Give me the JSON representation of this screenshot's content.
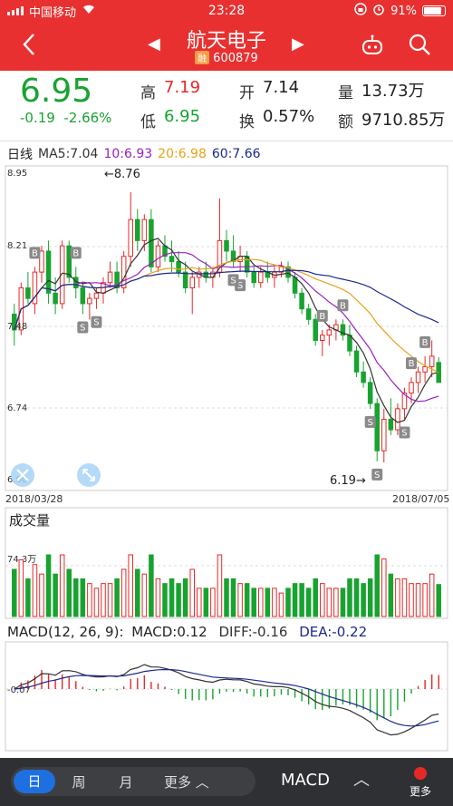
{
  "status": {
    "carrier": "中国移动",
    "time": "23:28",
    "battery": "91%"
  },
  "nav": {
    "stock_name": "航天电子",
    "rong_badge": "融",
    "stock_code": "600879",
    "prev": "◀",
    "next": "▶",
    "back": "〈"
  },
  "quote": {
    "price": "6.95",
    "change": "-0.19",
    "change_pct": "-2.66%",
    "high_label": "高",
    "high": "7.19",
    "low_label": "低",
    "low": "6.95",
    "open_label": "开",
    "open": "7.14",
    "turnover_label": "换",
    "turnover": "0.57%",
    "volume_label": "量",
    "volume": "13.73万",
    "amount_label": "额",
    "amount": "9710.85万"
  },
  "ma_legend": {
    "period": "日线",
    "ma5": "MA5:7.04",
    "ma10": "10:6.93",
    "ma20": "20:6.98",
    "ma60": "60:7.66"
  },
  "colors": {
    "up": "#e62828",
    "down": "#18a330",
    "ma5": "#333333",
    "ma10": "#9b1fc1",
    "ma20": "#e7a21a",
    "ma60": "#1a2a8c",
    "header": "#e93030"
  },
  "price_axis": {
    "p1": "8.95",
    "p2": "8.21",
    "p3": "7.48",
    "p4": "6.74",
    "p5": "6.00",
    "start_date": "2018/03/28",
    "end_date": "2018/07/05",
    "high_mark": "←8.76",
    "low_mark": "6.19→"
  },
  "volume_panel": {
    "title": "成交量",
    "max_label": "74.3万"
  },
  "macd_panel": {
    "legend": "MACD(12, 26, 9):",
    "macd": "MACD:0.12",
    "diff": "DIFF:-0.16",
    "dea": "DEA:-0.22",
    "axis_label": "-0.07"
  },
  "bottom": {
    "day": "日",
    "week": "周",
    "month": "月",
    "more_period": "更多 ︿",
    "indicator": "MACD",
    "caret": "︿",
    "more": "更多"
  },
  "chart_data": {
    "type": "candlestick",
    "x_range": [
      "2018/03/28",
      "2018/07/05"
    ],
    "ylim": [
      6.0,
      8.95
    ],
    "y_ticks": [
      8.95,
      8.21,
      7.48,
      6.74,
      6.0
    ],
    "annotations": [
      {
        "text": "←8.76",
        "value": 8.76
      },
      {
        "text": "6.19→",
        "value": 6.19
      }
    ],
    "markers": [
      "B",
      "S",
      "S",
      "B",
      "S",
      "S",
      "B",
      "B",
      "S",
      "S",
      "S",
      "B",
      "B"
    ],
    "candles_ohlc": [
      [
        7.6,
        7.7,
        7.3,
        7.45
      ],
      [
        7.45,
        7.9,
        7.4,
        7.85
      ],
      [
        7.85,
        8.0,
        7.7,
        7.75
      ],
      [
        7.7,
        8.05,
        7.6,
        8.0
      ],
      [
        8.0,
        8.25,
        7.9,
        8.2
      ],
      [
        8.2,
        8.3,
        7.7,
        7.8
      ],
      [
        7.8,
        7.95,
        7.6,
        7.7
      ],
      [
        7.7,
        8.3,
        7.65,
        8.25
      ],
      [
        8.25,
        8.3,
        7.9,
        7.95
      ],
      [
        7.95,
        8.05,
        7.75,
        7.85
      ],
      [
        7.85,
        7.9,
        7.6,
        7.7
      ],
      [
        7.7,
        7.8,
        7.55,
        7.75
      ],
      [
        7.75,
        7.85,
        7.65,
        7.8
      ],
      [
        7.8,
        7.95,
        7.7,
        7.9
      ],
      [
        7.9,
        8.1,
        7.85,
        8.0
      ],
      [
        8.0,
        8.1,
        7.8,
        7.85
      ],
      [
        7.85,
        8.2,
        7.8,
        8.15
      ],
      [
        8.15,
        8.76,
        8.05,
        8.5
      ],
      [
        8.5,
        8.6,
        8.2,
        8.3
      ],
      [
        8.3,
        8.55,
        8.2,
        8.5
      ],
      [
        8.5,
        8.6,
        8.0,
        8.05
      ],
      [
        8.05,
        8.3,
        8.0,
        8.25
      ],
      [
        8.25,
        8.35,
        8.1,
        8.15
      ],
      [
        8.15,
        8.3,
        8.0,
        8.1
      ],
      [
        8.1,
        8.2,
        7.95,
        8.0
      ],
      [
        8.0,
        8.1,
        7.8,
        7.85
      ],
      [
        7.85,
        8.0,
        7.6,
        7.95
      ],
      [
        7.95,
        8.05,
        7.85,
        8.0
      ],
      [
        8.0,
        8.1,
        7.9,
        7.95
      ],
      [
        7.95,
        8.05,
        7.85,
        8.0
      ],
      [
        8.0,
        8.7,
        7.95,
        8.3
      ],
      [
        8.3,
        8.4,
        8.1,
        8.2
      ],
      [
        8.2,
        8.35,
        8.05,
        8.1
      ],
      [
        8.1,
        8.25,
        8.0,
        8.15
      ],
      [
        8.15,
        8.2,
        7.95,
        8.0
      ],
      [
        8.0,
        8.05,
        7.85,
        7.9
      ],
      [
        7.9,
        8.05,
        7.85,
        8.0
      ],
      [
        8.0,
        8.1,
        7.9,
        7.95
      ],
      [
        7.95,
        8.05,
        7.85,
        8.0
      ],
      [
        8.0,
        8.1,
        7.95,
        8.05
      ],
      [
        8.05,
        8.1,
        7.9,
        7.95
      ],
      [
        7.95,
        8.0,
        7.75,
        7.8
      ],
      [
        7.8,
        7.85,
        7.6,
        7.65
      ],
      [
        7.65,
        7.7,
        7.5,
        7.55
      ],
      [
        7.55,
        7.6,
        7.3,
        7.35
      ],
      [
        7.35,
        7.45,
        7.2,
        7.4
      ],
      [
        7.4,
        7.5,
        7.3,
        7.45
      ],
      [
        7.45,
        7.55,
        7.35,
        7.5
      ],
      [
        7.5,
        7.55,
        7.35,
        7.4
      ],
      [
        7.4,
        7.5,
        7.2,
        7.25
      ],
      [
        7.25,
        7.3,
        7.0,
        7.05
      ],
      [
        7.05,
        7.15,
        6.9,
        6.95
      ],
      [
        6.95,
        7.0,
        6.7,
        6.75
      ],
      [
        6.75,
        6.8,
        6.2,
        6.3
      ],
      [
        6.3,
        6.7,
        6.19,
        6.6
      ],
      [
        6.6,
        6.8,
        6.45,
        6.5
      ],
      [
        6.5,
        6.75,
        6.45,
        6.7
      ],
      [
        6.7,
        6.9,
        6.6,
        6.85
      ],
      [
        6.85,
        7.0,
        6.75,
        6.95
      ],
      [
        6.95,
        7.1,
        6.85,
        7.05
      ],
      [
        7.05,
        7.2,
        6.95,
        7.1
      ],
      [
        7.1,
        7.35,
        7.0,
        7.2
      ],
      [
        7.14,
        7.19,
        6.95,
        6.95
      ]
    ]
  }
}
